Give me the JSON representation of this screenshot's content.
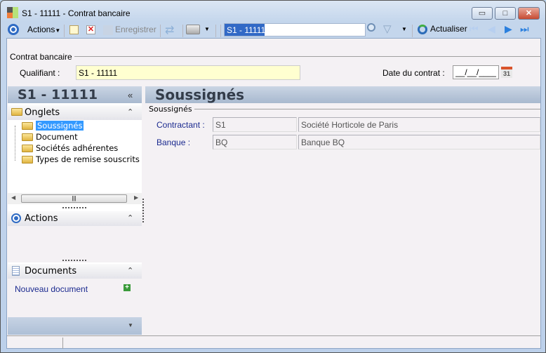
{
  "window": {
    "title": "S1 - 11111 -  Contrat bancaire",
    "minimize": "▭",
    "maximize": "□",
    "close": "✕"
  },
  "toolbar": {
    "actions_label": "Actions",
    "save_label": "Enregistrer",
    "search_value": "S1 - 11111",
    "refresh_label": "Actualiser"
  },
  "form": {
    "group_title": "Contrat bancaire",
    "qualifiant_label": "Qualifiant :",
    "qualifiant_value": "S1 - 11111",
    "date_label": "Date du contrat :",
    "date_value": "__/__/____",
    "calendar_day": "31"
  },
  "left": {
    "title": "S1 - 11111",
    "collapse": "«",
    "onglets": {
      "title": "Onglets",
      "items": [
        "Soussignés",
        "Document",
        "Sociétés adhérentes",
        "Types de remise souscrits"
      ]
    },
    "actions": {
      "title": "Actions"
    },
    "documents": {
      "title": "Documents",
      "new_doc": "Nouveau document"
    }
  },
  "main": {
    "title": "Soussignés",
    "group_title": "Soussignés",
    "rows": [
      {
        "label": "Contractant :",
        "code": "S1",
        "name": "Société Horticole de Paris"
      },
      {
        "label": "Banque :",
        "code": "BQ",
        "name": "Banque BQ"
      }
    ]
  }
}
